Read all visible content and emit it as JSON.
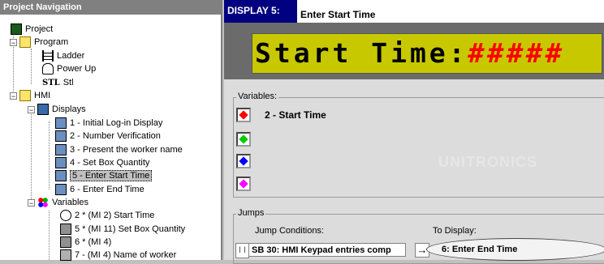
{
  "nav": {
    "title": "Project Navigation",
    "items": [
      {
        "label": "Project"
      },
      {
        "label": "Program"
      },
      {
        "label": "Ladder"
      },
      {
        "label": "Power Up"
      },
      {
        "label": "Stl"
      },
      {
        "label": "HMI"
      },
      {
        "label": "Displays"
      },
      {
        "label": "1 - Initial Log-in Display"
      },
      {
        "label": "2 - Number Verification"
      },
      {
        "label": "3 - Present the worker name"
      },
      {
        "label": "4 - Set Box Quantity"
      },
      {
        "label": "5 - Enter Start Time"
      },
      {
        "label": "6 - Enter End Time"
      },
      {
        "label": "Variables"
      },
      {
        "label": "2 * (MI 2)  Start Time"
      },
      {
        "label": "5 * (MI 11)  Set Box Quantity"
      },
      {
        "label": "6 * (MI 4)"
      },
      {
        "label": "7 - (MI 4)  Name of worker"
      }
    ],
    "stl_icon_text": "STL"
  },
  "display": {
    "label": "DISPLAY 5:",
    "name": "Enter Start Time",
    "lcd_text": "Start Time:",
    "lcd_value": "#####",
    "watermark": "UNITRONICS"
  },
  "variables": {
    "title": "Variables:",
    "slots": [
      {
        "color": "#ff0000",
        "text": "2 - Start Time"
      },
      {
        "color": "#00cc00",
        "text": ""
      },
      {
        "color": "#0000ff",
        "text": ""
      },
      {
        "color": "#ff00ff",
        "text": ""
      }
    ]
  },
  "jumps": {
    "title": "Jumps",
    "col_conditions": "Jump Conditions:",
    "col_to_display": "To Display:",
    "row": {
      "prefix": "I I",
      "condition": "SB  30: HMI Keypad entries comp",
      "arrow": "→",
      "target": "6: Enter End Time"
    }
  }
}
